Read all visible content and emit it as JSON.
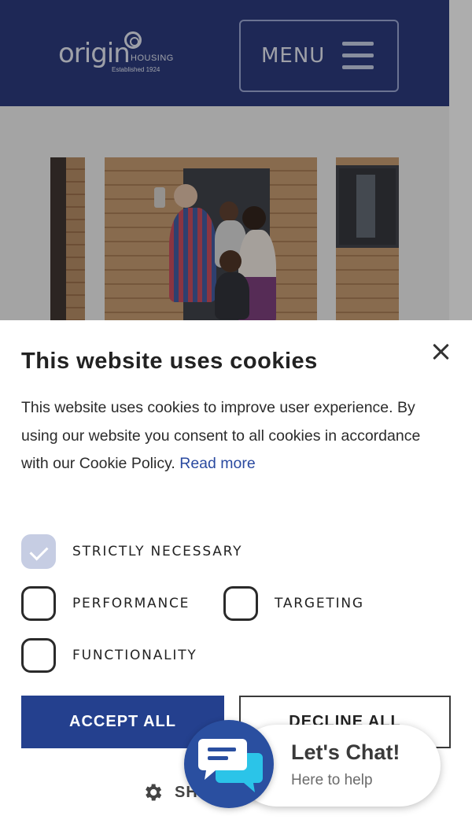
{
  "header": {
    "logo_word": "origin",
    "logo_sub": "HOUSING",
    "logo_est": "Established 1924",
    "menu_label": "MENU"
  },
  "cookie": {
    "title": "This website uses cookies",
    "text": "This website uses cookies to improve user experience. By using our website you consent to all cookies in accordance with our Cookie Policy.",
    "read_more": "Read more",
    "options": [
      {
        "label": "STRICTLY NECESSARY",
        "checked": true
      },
      {
        "label": "PERFORMANCE",
        "checked": false
      },
      {
        "label": "TARGETING",
        "checked": false
      },
      {
        "label": "FUNCTIONALITY",
        "checked": false
      }
    ],
    "accept_label": "ACCEPT ALL",
    "decline_label": "DECLINE ALL",
    "settings_label": "SH"
  },
  "chat": {
    "title": "Let's Chat!",
    "subtitle": "Here to help"
  },
  "colors": {
    "header": "#24347a",
    "accent": "#24408e",
    "chat": "#2a4fa0",
    "chat_icon_secondary": "#2bc4e8"
  }
}
